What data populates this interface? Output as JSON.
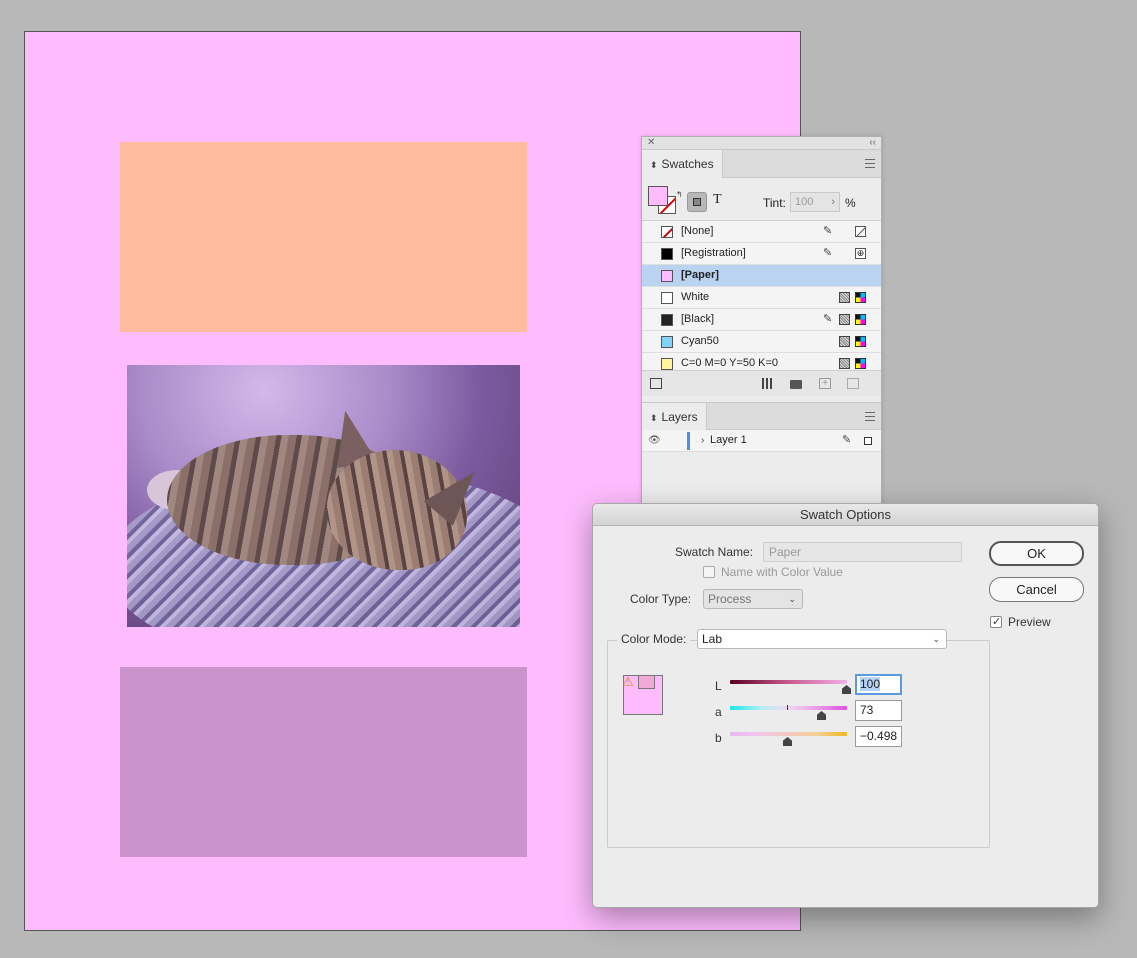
{
  "swatches_panel": {
    "tab_label": "Swatches",
    "tint_label": "Tint:",
    "tint_value": "100",
    "tint_unit": "%",
    "swatches": [
      {
        "name": "[None]",
        "color": "none"
      },
      {
        "name": "[Registration]",
        "color": "#000000"
      },
      {
        "name": "[Paper]",
        "color": "#febcfe"
      },
      {
        "name": "White",
        "color": "#ffffff"
      },
      {
        "name": "[Black]",
        "color": "#222222"
      },
      {
        "name": "Cyan50",
        "color": "#80d4f8"
      },
      {
        "name": "C=0 M=0 Y=50 K=0",
        "color": "#fff59c"
      }
    ]
  },
  "layers_panel": {
    "tab_label": "Layers",
    "layers": [
      {
        "name": "Layer 1"
      }
    ]
  },
  "dialog": {
    "title": "Swatch Options",
    "swatch_name_label": "Swatch Name:",
    "swatch_name_value": "Paper",
    "name_with_color_label": "Name with Color Value",
    "color_type_label": "Color Type:",
    "color_type_value": "Process",
    "color_mode_label": "Color Mode:",
    "color_mode_value": "Lab",
    "ok_label": "OK",
    "cancel_label": "Cancel",
    "preview_label": "Preview",
    "preview_checked": true,
    "sliders": [
      {
        "channel": "L",
        "value": "100"
      },
      {
        "channel": "a",
        "value": "73"
      },
      {
        "channel": "b",
        "value": "−0.498"
      }
    ]
  },
  "colors": {
    "paper": "#febcfe",
    "rect_orange": "#febc9e",
    "rect_mauve": "#ca93cb",
    "selection": "#b9d3f1"
  }
}
